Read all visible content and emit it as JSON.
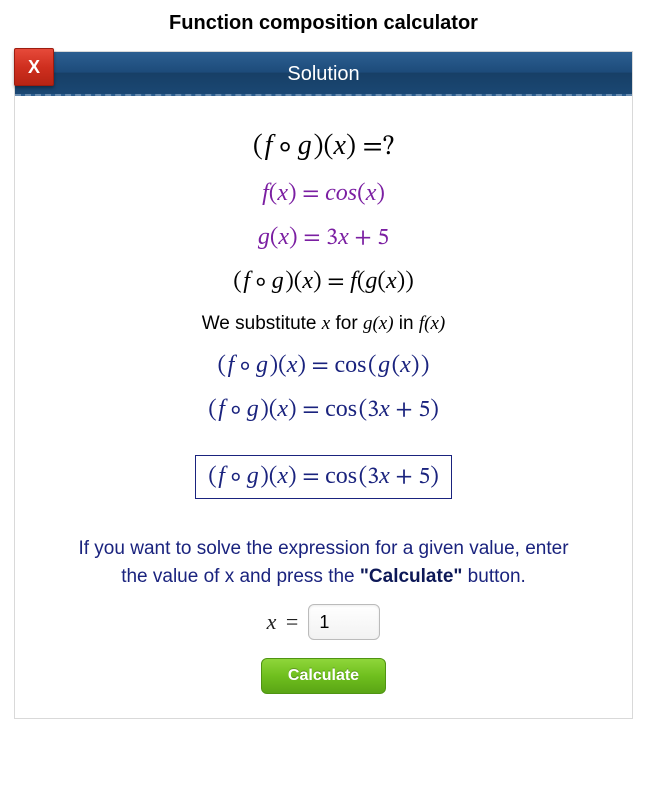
{
  "page": {
    "title": "Function composition calculator"
  },
  "panel": {
    "header": "Solution",
    "close_label": "X"
  },
  "equations": {
    "question": "( f ∘ g )(x) = ?",
    "f_def": "f(x) = cos(x)",
    "g_def": "g(x) = 3x + 5",
    "def_comp": "( f ∘ g )(x) = f(g(x))",
    "step1": "( f ∘ g )(x) = cos ( g (x) )",
    "step2": "( f ∘ g )(x) = cos (3x + 5)",
    "result": "( f ∘ g )(x) = cos (3x + 5)"
  },
  "explain": {
    "prefix": "We substitute ",
    "var_x": "x",
    "mid": " for ",
    "gx": "g(x)",
    "mid2": " in ",
    "fx": "f(x)"
  },
  "instruction": {
    "line1": "If you want to solve the expression for a given value, enter",
    "line2_pre": "the value of x and press the ",
    "line2_bold": "\"Calculate\"",
    "line2_post": " button."
  },
  "form": {
    "x_label": "x",
    "eq_sign": " = ",
    "x_value": "1",
    "calculate_label": "Calculate"
  }
}
